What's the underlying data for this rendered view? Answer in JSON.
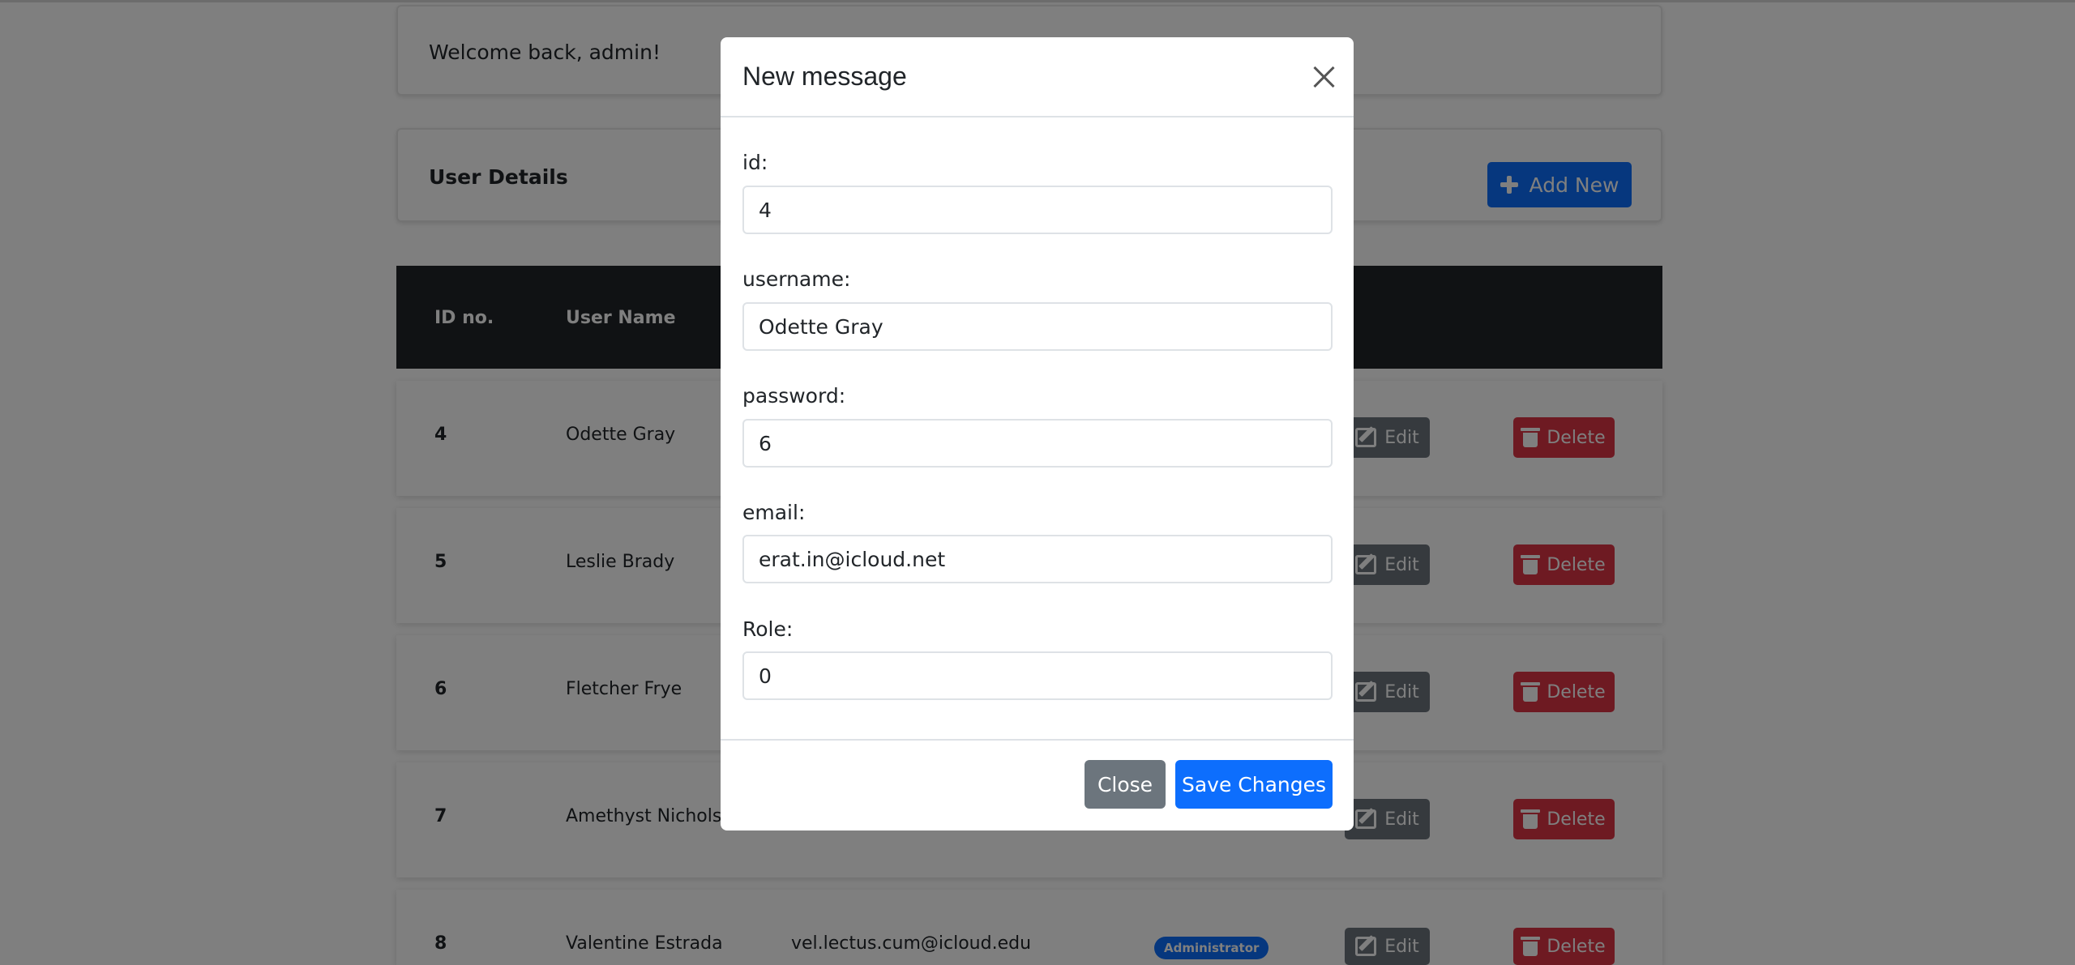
{
  "page": {
    "welcome": "Welcome back, admin!",
    "details_title": "User Details",
    "add_new_label": "Add New",
    "table": {
      "headers": [
        "ID no.",
        "User Name"
      ],
      "rows": [
        {
          "id": "4",
          "name": "Odette Gray",
          "email": "",
          "role": ""
        },
        {
          "id": "5",
          "name": "Leslie Brady",
          "email": "",
          "role": ""
        },
        {
          "id": "6",
          "name": "Fletcher Frye",
          "email": "",
          "role": ""
        },
        {
          "id": "7",
          "name": "Amethyst Nichols",
          "email": "",
          "role": ""
        },
        {
          "id": "8",
          "name": "Valentine Estrada",
          "email": "vel.lectus.cum@icloud.edu",
          "role": "Administrator"
        }
      ],
      "edit_label": "Edit",
      "delete_label": "Delete"
    }
  },
  "modal": {
    "title": "New message",
    "fields": [
      {
        "label": "id:",
        "value": "4"
      },
      {
        "label": "username:",
        "value": "Odette Gray"
      },
      {
        "label": "password:",
        "value": "6"
      },
      {
        "label": "email:",
        "value": "erat.in@icloud.net"
      },
      {
        "label": "Role:",
        "value": "0"
      }
    ],
    "close_label": "Close",
    "save_label": "Save Changes"
  },
  "colors": {
    "primary": "#0d6efd",
    "secondary": "#6c757d",
    "danger": "#dc3545",
    "dark": "#212529"
  }
}
